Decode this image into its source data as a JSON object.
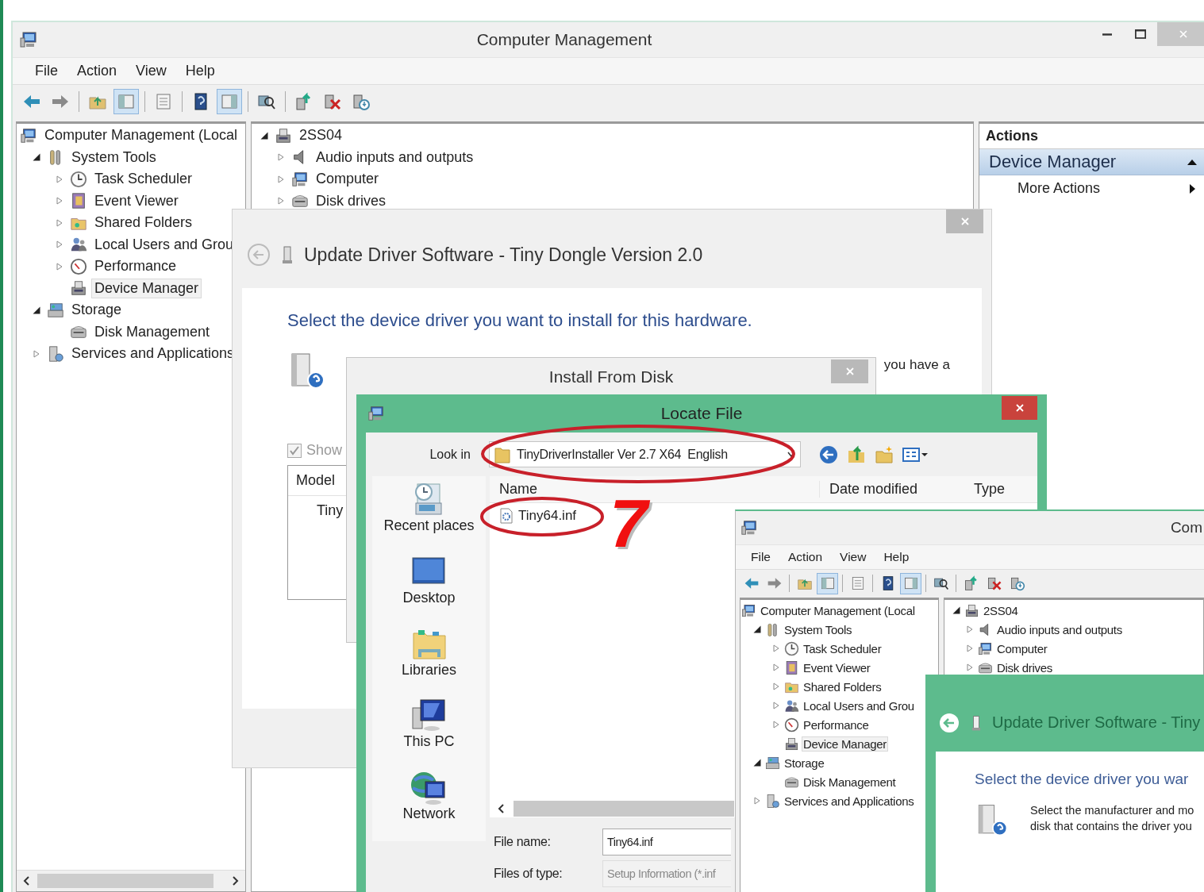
{
  "main_window": {
    "title": "Computer Management",
    "menu": [
      "File",
      "Action",
      "View",
      "Help"
    ],
    "toolbar": [
      {
        "kind": "back",
        "pressed": false
      },
      {
        "kind": "forward",
        "pressed": false
      },
      {
        "kind": "separator"
      },
      {
        "kind": "up",
        "pressed": false
      },
      {
        "kind": "tree",
        "pressed": true
      },
      {
        "kind": "separator"
      },
      {
        "kind": "properties",
        "pressed": false
      },
      {
        "kind": "separator"
      },
      {
        "kind": "help",
        "pressed": false
      },
      {
        "kind": "pane",
        "pressed": true
      },
      {
        "kind": "separator"
      },
      {
        "kind": "scan",
        "pressed": false
      },
      {
        "kind": "separator"
      },
      {
        "kind": "update",
        "pressed": false
      },
      {
        "kind": "uninstall",
        "pressed": false
      },
      {
        "kind": "enable",
        "pressed": false
      }
    ],
    "tree": [
      {
        "label": "Computer Management (Local",
        "kind": "computer",
        "selected": false,
        "children": [
          {
            "label": "System Tools",
            "kind": "tools",
            "expanded": true,
            "selected": false,
            "children": [
              {
                "label": "Task Scheduler",
                "kind": "clock",
                "expanded": false,
                "selected": false
              },
              {
                "label": "Event Viewer",
                "kind": "log",
                "expanded": false,
                "selected": false
              },
              {
                "label": "Shared Folders",
                "kind": "folder",
                "expanded": false,
                "selected": false
              },
              {
                "label": "Local Users and Grou",
                "kind": "users",
                "expanded": false,
                "selected": false
              },
              {
                "label": "Performance",
                "kind": "gauge",
                "expanded": false,
                "selected": false
              },
              {
                "label": "Device Manager",
                "kind": "device",
                "selected": true
              }
            ]
          },
          {
            "label": "Storage",
            "kind": "storage",
            "expanded": true,
            "selected": false,
            "children": [
              {
                "label": "Disk Management",
                "kind": "disk",
                "selected": false
              }
            ]
          },
          {
            "label": "Services and Applications",
            "kind": "services",
            "expanded": false,
            "selected": false
          }
        ]
      }
    ],
    "devices": [
      {
        "label": "2SS04",
        "kind": "device",
        "expanded": true,
        "selected": false,
        "children": [
          {
            "label": "Audio inputs and outputs",
            "kind": "speaker",
            "expanded": false,
            "selected": false
          },
          {
            "label": "Computer",
            "kind": "computer",
            "expanded": false,
            "selected": false
          },
          {
            "label": "Disk drives",
            "kind": "disk",
            "expanded": false,
            "selected": false
          }
        ]
      }
    ],
    "actions": {
      "header": "Actions",
      "section": "Device Manager",
      "items": [
        "More Actions"
      ]
    }
  },
  "update_dialog": {
    "title": "Update Driver Software - Tiny Dongle Version 2.0",
    "heading": "Select the device driver you want to install for this hardware.",
    "description": "you have a",
    "show_compatible": {
      "label": "Show",
      "checked": true,
      "disabled": true
    },
    "model_header": "Model",
    "models": [
      "Tiny"
    ]
  },
  "install_from_disk": {
    "title": "Install From Disk"
  },
  "locate_file": {
    "title": "Locate File",
    "look_in_label": "Look in",
    "look_in": "TinyDriverInstaller Ver 2.7 X64  English",
    "places": [
      {
        "label": "Recent places",
        "kind": "recent"
      },
      {
        "label": "Desktop",
        "kind": "desktop"
      },
      {
        "label": "Libraries",
        "kind": "libraries"
      },
      {
        "label": "This PC",
        "kind": "pc"
      },
      {
        "label": "Network",
        "kind": "network"
      }
    ],
    "columns": [
      "Name",
      "Date modified",
      "Type"
    ],
    "files": [
      "Tiny64.inf"
    ],
    "file_name_label": "File name:",
    "file_name": "Tiny64.inf",
    "file_type_label": "Files of type:",
    "file_type": "Setup Information (*.inf"
  },
  "annotation": {
    "step": "7"
  },
  "second_window": {
    "title": "Com",
    "menu": [
      "File",
      "Action",
      "View",
      "Help"
    ],
    "toolbar": [
      {
        "kind": "back",
        "pressed": false
      },
      {
        "kind": "forward",
        "pressed": false
      },
      {
        "kind": "separator"
      },
      {
        "kind": "up",
        "pressed": false
      },
      {
        "kind": "tree",
        "pressed": true
      },
      {
        "kind": "separator"
      },
      {
        "kind": "properties",
        "pressed": false
      },
      {
        "kind": "separator"
      },
      {
        "kind": "help",
        "pressed": false
      },
      {
        "kind": "pane",
        "pressed": true
      },
      {
        "kind": "separator"
      },
      {
        "kind": "scan",
        "pressed": false
      },
      {
        "kind": "separator"
      },
      {
        "kind": "update",
        "pressed": false
      },
      {
        "kind": "uninstall",
        "pressed": false
      },
      {
        "kind": "enable",
        "pressed": false
      }
    ],
    "tree": [
      {
        "label": "Computer Management (Local",
        "kind": "computer",
        "selected": false,
        "children": [
          {
            "label": "System Tools",
            "kind": "tools",
            "expanded": true,
            "selected": false,
            "children": [
              {
                "label": "Task Scheduler",
                "kind": "clock",
                "expanded": false,
                "selected": false
              },
              {
                "label": "Event Viewer",
                "kind": "log",
                "expanded": false,
                "selected": false
              },
              {
                "label": "Shared Folders",
                "kind": "folder",
                "expanded": false,
                "selected": false
              },
              {
                "label": "Local Users and Grou",
                "kind": "users",
                "expanded": false,
                "selected": false
              },
              {
                "label": "Performance",
                "kind": "gauge",
                "expanded": false,
                "selected": false
              },
              {
                "label": "Device Manager",
                "kind": "device",
                "selected": true
              }
            ]
          },
          {
            "label": "Storage",
            "kind": "storage",
            "expanded": true,
            "selected": false,
            "children": [
              {
                "label": "Disk Management",
                "kind": "disk",
                "selected": false
              }
            ]
          },
          {
            "label": "Services and Applications",
            "kind": "services",
            "expanded": false,
            "selected": false
          }
        ]
      }
    ],
    "devices": [
      {
        "label": "2SS04",
        "kind": "device",
        "expanded": true,
        "selected": false,
        "children": [
          {
            "label": "Audio inputs and outputs",
            "kind": "speaker",
            "expanded": false,
            "selected": false
          },
          {
            "label": "Computer",
            "kind": "computer",
            "expanded": false,
            "selected": false
          },
          {
            "label": "Disk drives",
            "kind": "disk",
            "expanded": false,
            "selected": false
          }
        ]
      }
    ]
  },
  "second_update_dialog": {
    "title": "Update Driver Software - Tiny",
    "heading": "Select the device driver you war",
    "description": [
      "Select the manufacturer and mo",
      "disk that contains the driver you"
    ]
  }
}
